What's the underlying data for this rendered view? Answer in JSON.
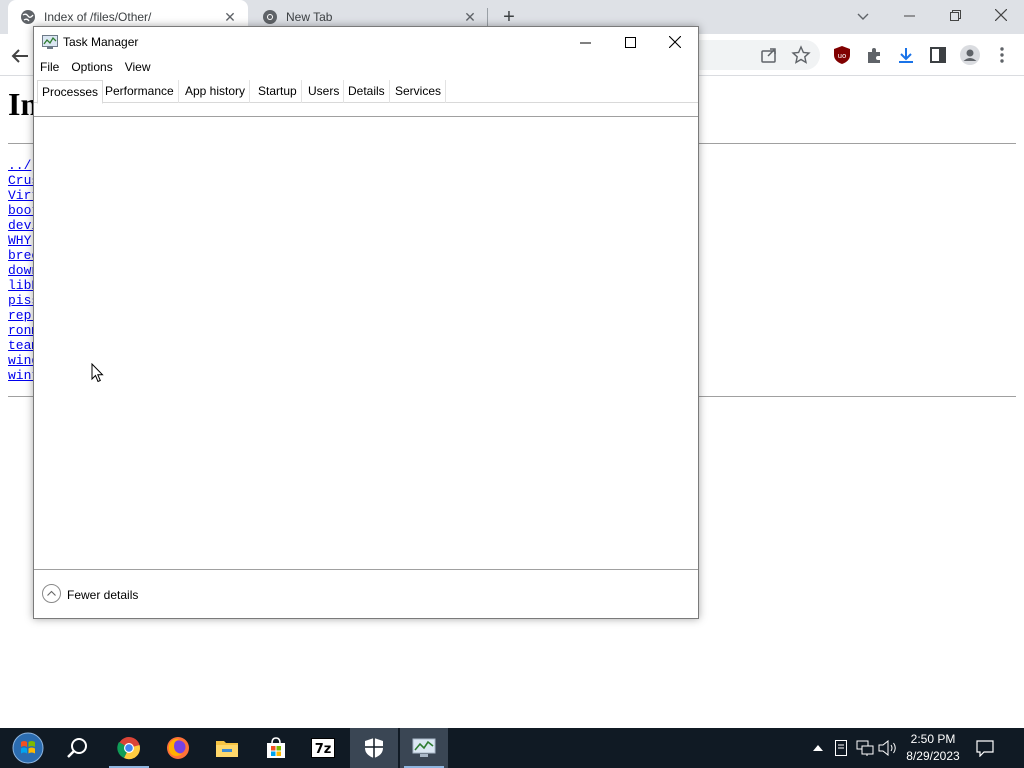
{
  "browser": {
    "tabs": [
      {
        "title": "Index of /files/Other/"
      },
      {
        "title": "New Tab"
      }
    ],
    "colors": {
      "frame": "#dee1e6",
      "link": "#0000ee"
    }
  },
  "page": {
    "heading": "In",
    "entries": [
      "../",
      "Crus",
      "Virt",
      "boot",
      "devi",
      "WHY ",
      "bree",
      "down",
      "libE",
      "piss",
      "repl",
      "ronm",
      "team",
      "wind",
      "wint"
    ]
  },
  "task_manager": {
    "title": "Task Manager",
    "menus": [
      "File",
      "Options",
      "View"
    ],
    "tabs": [
      "Processes",
      "Performance",
      "App history",
      "Startup",
      "Users",
      "Details",
      "Services"
    ],
    "active_tab": "Processes",
    "footer_label": "Fewer details"
  },
  "taskbar": {
    "apps": [
      "start-icon",
      "search-icon",
      "chrome-icon",
      "firefox-icon",
      "file-explorer-icon",
      "store-icon",
      "7zip-icon",
      "security-icon",
      "task-manager-icon"
    ],
    "clock": {
      "time": "2:50 PM",
      "date": "8/29/2023"
    }
  }
}
